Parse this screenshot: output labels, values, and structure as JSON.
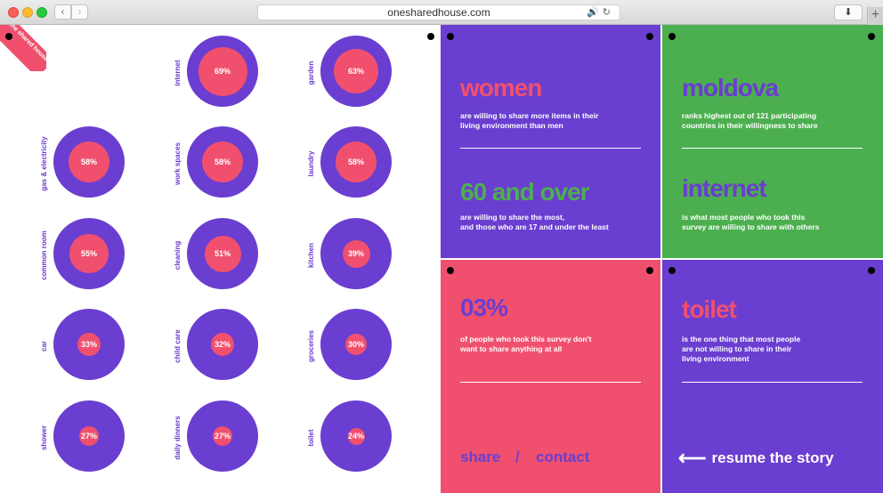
{
  "browser": {
    "url": "onesharedhouse.com",
    "back_icon": "‹",
    "forward_icon": "›",
    "download_icon": "⬇",
    "newtab_icon": "+"
  },
  "logo": {
    "text": "one shared house"
  },
  "colors": {
    "purple": "#6a3ed0",
    "pink": "#f0506e",
    "green": "#4caf4f"
  },
  "items": [
    {
      "label": "internet",
      "value": "69%"
    },
    {
      "label": "garden",
      "value": "63%"
    },
    {
      "label": "gas & electricity",
      "value": "58%"
    },
    {
      "label": "work spaces",
      "value": "58%"
    },
    {
      "label": "laundry",
      "value": "58%"
    },
    {
      "label": "common room",
      "value": "55%"
    },
    {
      "label": "cleaning",
      "value": "51%"
    },
    {
      "label": "kitchen",
      "value": "39%"
    },
    {
      "label": "car",
      "value": "33%"
    },
    {
      "label": "child care",
      "value": "32%"
    },
    {
      "label": "groceries",
      "value": "30%"
    },
    {
      "label": "shower",
      "value": "27%"
    },
    {
      "label": "daily dinners",
      "value": "27%"
    },
    {
      "label": "toilet",
      "value": "24%"
    }
  ],
  "panels": {
    "women": {
      "title": "women",
      "desc": "are willing to share more items in their\nliving environment than men"
    },
    "sixty": {
      "title": "60 and over",
      "desc": "are willing to share the most,\nand those who are 17 and under the least"
    },
    "moldova": {
      "title": "moldova",
      "desc": "ranks highest out of 121 participating\ncountries in their willingness to share"
    },
    "internet": {
      "title": "internet",
      "desc": "is what most people who took this\nsurvey are willing to share with others"
    },
    "zero": {
      "title": "03%",
      "desc": "of people who took this survey don't\nwant to share anything at all"
    },
    "toilet": {
      "title": "toilet",
      "desc": "is the one thing that most people\nare not willing to share in their\nliving environment"
    }
  },
  "footer": {
    "share": "share",
    "slash": "/",
    "contact": "contact",
    "resume": "resume the story"
  }
}
